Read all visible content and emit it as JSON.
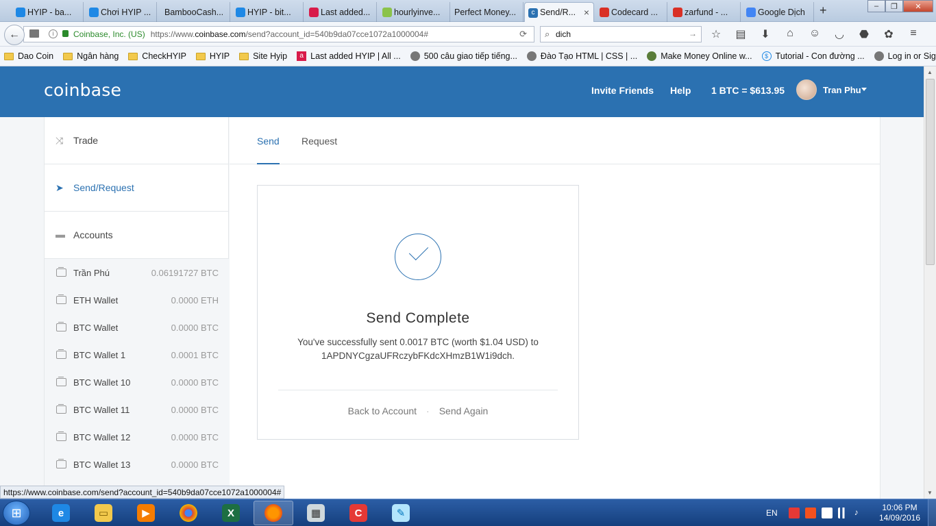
{
  "browser": {
    "tabs": [
      {
        "label": "HYIP - ba...",
        "fav_color": "#1e88e5"
      },
      {
        "label": "Chơi HYIP ...",
        "fav_color": "#1e88e5"
      },
      {
        "label": "BambooCash...",
        "fav_color": "#f0f0f0"
      },
      {
        "label": "HYIP - bit...",
        "fav_color": "#1e88e5"
      },
      {
        "label": "Last added...",
        "fav_color": "#d81b4a"
      },
      {
        "label": "hourlyinve...",
        "fav_color": "#8bc34a"
      },
      {
        "label": "Perfect Money...",
        "fav_color": "#f0f0f0"
      },
      {
        "label": "Send/R...",
        "fav_color": "#2b71b1",
        "active": true
      },
      {
        "label": "Codecard ...",
        "fav_color": "#d93025"
      },
      {
        "label": "zarfund - ...",
        "fav_color": "#d93025"
      },
      {
        "label": "Google Dịch",
        "fav_color": "#4285f4"
      }
    ],
    "new_tab_label": "+",
    "identity": "Coinbase, Inc. (US)",
    "url_prefix": "https://www.",
    "url_domain": "coinbase.com",
    "url_rest": "/send?account_id=540b9da07cce1072a1000004#",
    "search_value": "dich",
    "bookmarks": [
      {
        "label": "Dao Coin",
        "icon": "folder"
      },
      {
        "label": "Ngân hàng",
        "icon": "folder"
      },
      {
        "label": "CheckHYIP",
        "icon": "folder"
      },
      {
        "label": "HYIP",
        "icon": "folder"
      },
      {
        "label": "Site Hyip",
        "icon": "folder"
      },
      {
        "label": "Last added HYIP | All ...",
        "icon": "a"
      },
      {
        "label": "500 câu giao tiếp tiếng...",
        "icon": "globe"
      },
      {
        "label": "Đào Tạo HTML | CSS | ...",
        "icon": "globe"
      },
      {
        "label": "Make Money Online w...",
        "icon": "globe"
      },
      {
        "label": "Tutorial - Con đường ...",
        "icon": "s"
      },
      {
        "label": "Log in or Sign up",
        "icon": "globe"
      }
    ],
    "status_url": "https://www.coinbase.com/send?account_id=540b9da07cce1072a1000004#"
  },
  "header": {
    "logo": "coinbase",
    "invite": "Invite Friends",
    "help": "Help",
    "price": "1 BTC = $613.95",
    "user": "Tran Phu"
  },
  "sidebar": {
    "trade": "Trade",
    "send_request": "Send/Request",
    "accounts": "Accounts",
    "wallets": [
      {
        "name": "Trần Phú",
        "balance": "0.06191727 BTC"
      },
      {
        "name": "ETH Wallet",
        "balance": "0.0000 ETH"
      },
      {
        "name": "BTC Wallet",
        "balance": "0.0000 BTC"
      },
      {
        "name": "BTC Wallet 1",
        "balance": "0.0001 BTC"
      },
      {
        "name": "BTC Wallet 10",
        "balance": "0.0000 BTC"
      },
      {
        "name": "BTC Wallet 11",
        "balance": "0.0000 BTC"
      },
      {
        "name": "BTC Wallet 12",
        "balance": "0.0000 BTC"
      },
      {
        "name": "BTC Wallet 13",
        "balance": "0.0000 BTC"
      }
    ]
  },
  "main": {
    "tab_send": "Send",
    "tab_request": "Request",
    "title": "Send Complete",
    "message_line1": "You've successfully sent 0.0017 BTC (worth $1.04 USD) to",
    "message_line2": "1APDNYCgzaUFRczybFKdcXHmzB1W1i9dch.",
    "back_label": "Back to Account",
    "separator": "·",
    "send_again_label": "Send Again"
  },
  "taskbar": {
    "lang": "EN",
    "time": "10:06 PM",
    "date": "14/09/2016"
  },
  "colors": {
    "brand_blue": "#2b71b1"
  }
}
